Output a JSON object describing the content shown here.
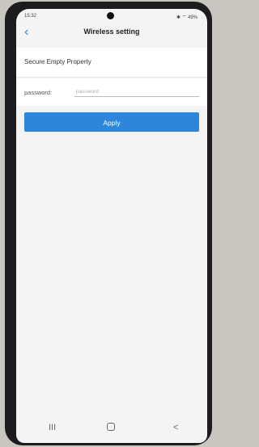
{
  "statusbar": {
    "time": "15:32",
    "right": "✱ ⌔ 49%"
  },
  "header": {
    "title": "Wireless setting"
  },
  "network": {
    "name": "Secure Empty Property"
  },
  "password": {
    "label": "password:",
    "placeholder": "password",
    "value": ""
  },
  "actions": {
    "apply_label": "Apply"
  },
  "navbar": {
    "recents": "III",
    "back": "<"
  }
}
